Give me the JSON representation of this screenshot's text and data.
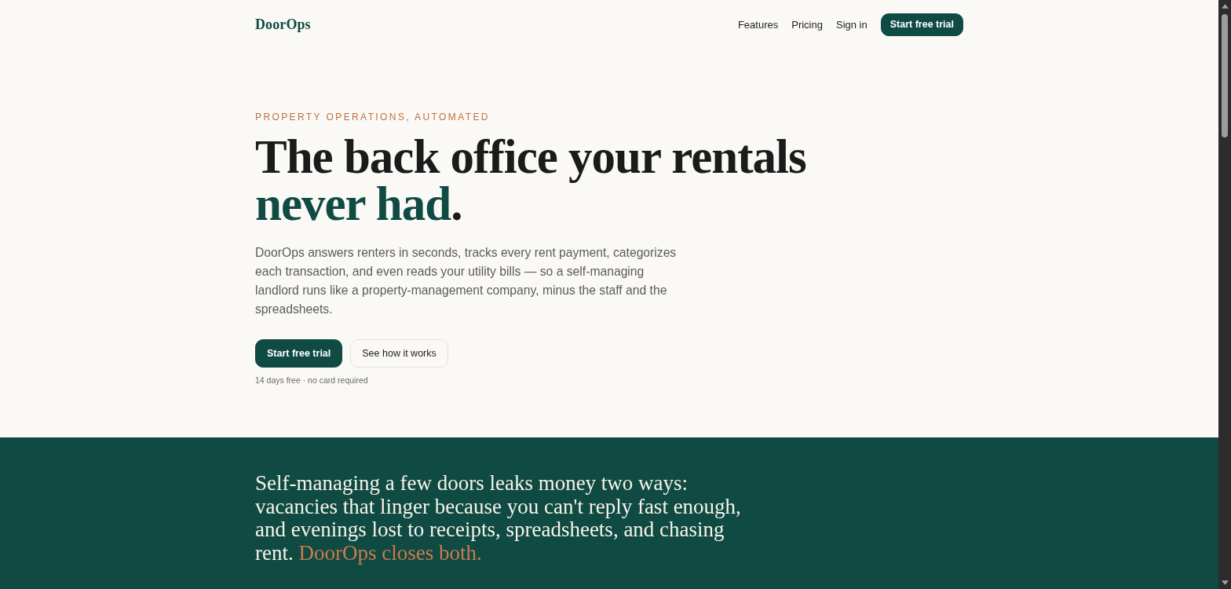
{
  "nav": {
    "logo": "DoorOps",
    "links": [
      "Features",
      "Pricing",
      "Sign in"
    ],
    "cta": "Start free trial"
  },
  "hero": {
    "eyebrow": "PROPERTY OPERATIONS, AUTOMATED",
    "headline": [
      {
        "text": "The back office your rentals ",
        "accent": false
      },
      {
        "text": "never had",
        "accent": true
      },
      {
        "text": ".",
        "accent": false
      }
    ],
    "body": "DoorOps answers renters in seconds, tracks every rent payment, categorizes each transaction, and even reads your utility bills — so a self-managing landlord runs like a property-management company, minus the staff and the spreadsheets.",
    "buttons": [
      {
        "label": "Start free trial",
        "kind": "primary"
      },
      {
        "label": "See how it works",
        "kind": "secondary"
      }
    ],
    "note": "14 days free · no card required"
  },
  "problem": {
    "statement": [
      {
        "text": "Self-managing a few doors leaks money two ways: vacancies that linger because you can't reply fast enough, and evenings lost to receipts, spreadsheets, and chasing rent. ",
        "accent": false
      },
      {
        "text": "DoorOps closes both.",
        "accent": true
      }
    ]
  }
}
